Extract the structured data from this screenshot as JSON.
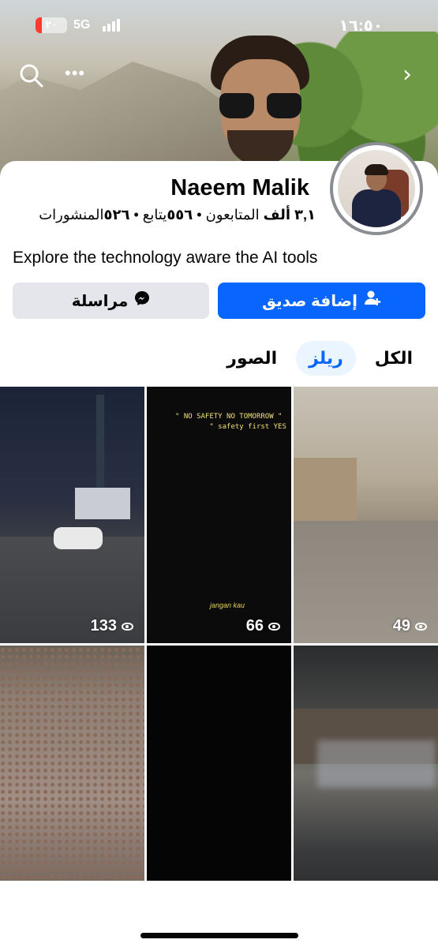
{
  "status_bar": {
    "time": "١٦:٥٠",
    "network": "5G",
    "battery_level": "٢٠",
    "battery_fraction": 0.2
  },
  "header": {
    "icons": [
      "search-icon",
      "more-icon",
      "chevron-right-icon"
    ],
    "more_glyph": "•••",
    "chevron_glyph": "›"
  },
  "profile": {
    "name": "Naeem Malik",
    "stats": {
      "followers_value": "٣,١ ألف",
      "followers_label": "المتابعون",
      "separator_1": " • ",
      "following_value": "٥٥٦",
      "following_label": "يتابع",
      "separator_2": " • ",
      "posts_value": "٥٢٦",
      "posts_label": "المنشورات"
    },
    "bio": "Explore the technology aware the AI tools"
  },
  "actions": {
    "add_friend_label": "إضافة صديق",
    "message_label": "مراسلة"
  },
  "tabs": [
    {
      "label": "الكل",
      "active": false
    },
    {
      "label": "ريلز",
      "active": true
    },
    {
      "label": "الصور",
      "active": false
    }
  ],
  "reels": [
    {
      "views": "133"
    },
    {
      "views": "66",
      "caption": "\" NO SAFETY NO TOMORROW \"\n        \" safety first YES \"",
      "signature": "jangan kau"
    },
    {
      "views": "49"
    },
    {
      "views": ""
    },
    {
      "views": ""
    },
    {
      "views": ""
    }
  ],
  "colors": {
    "primary": "#0866ff",
    "secondary_button": "#e4e6eb",
    "active_tab_bg": "#ebf5ff",
    "battery_low": "#ff3b30"
  }
}
